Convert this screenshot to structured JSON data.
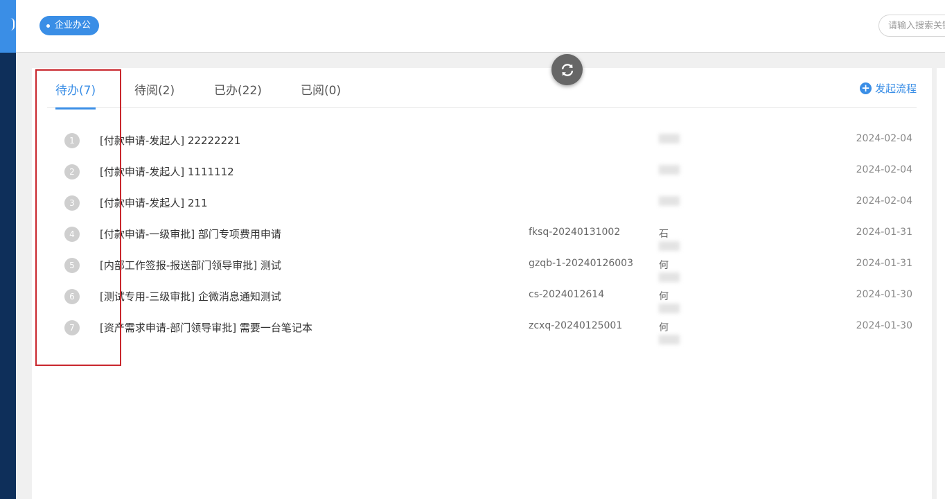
{
  "topbar": {
    "app_label": "企业办公",
    "search_placeholder": "请输入搜索关键词"
  },
  "tabs": [
    {
      "label": "待办(7)",
      "active": true
    },
    {
      "label": "待阅(2)",
      "active": false
    },
    {
      "label": "已办(22)",
      "active": false
    },
    {
      "label": "已阅(0)",
      "active": false
    }
  ],
  "launch_label": "发起流程",
  "rows": [
    {
      "index": "1",
      "title": "[付款申请-发起人] 22222221",
      "code": "",
      "person": "",
      "date": "2024-02-04"
    },
    {
      "index": "2",
      "title": "[付款申请-发起人] 1111112",
      "code": "",
      "person": "",
      "date": "2024-02-04"
    },
    {
      "index": "3",
      "title": "[付款申请-发起人] 211",
      "code": "",
      "person": "",
      "date": "2024-02-04"
    },
    {
      "index": "4",
      "title": "[付款申请-一级审批] 部门专项费用申请",
      "code": "fksq-20240131002",
      "person": "石",
      "date": "2024-01-31"
    },
    {
      "index": "5",
      "title": "[内部工作签报-报送部门领导审批] 测试",
      "code": "gzqb-1-20240126003",
      "person": "何",
      "date": "2024-01-31"
    },
    {
      "index": "6",
      "title": "[测试专用-三级审批] 企微消息通知测试",
      "code": "cs-2024012614",
      "person": "何",
      "date": "2024-01-30"
    },
    {
      "index": "7",
      "title": "[资产需求申请-部门领导审批] 需要一台笔记本",
      "code": "zcxq-20240125001",
      "person": "何",
      "date": "2024-01-30"
    }
  ],
  "colors": {
    "accent": "#3a8ee6",
    "sidebar": "#0e2f5a",
    "highlight": "#c9272d"
  }
}
